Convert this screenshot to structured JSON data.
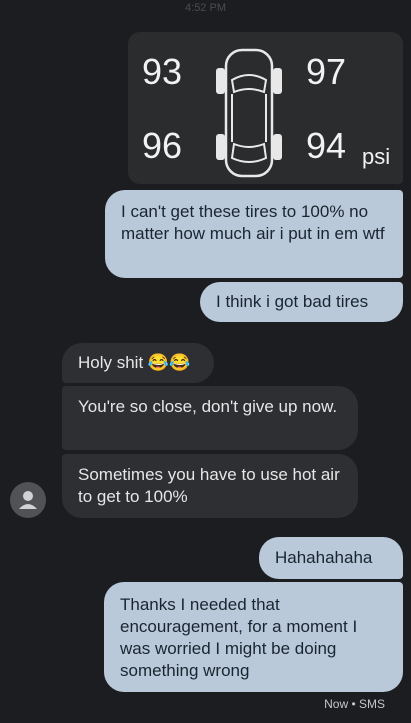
{
  "header": {
    "time": "4:52 PM"
  },
  "tire_image": {
    "front_left": "93",
    "front_right": "97",
    "rear_left": "96",
    "rear_right": "94",
    "unit": "psi"
  },
  "messages": [
    {
      "side": "out",
      "text": "I can't get these tires to 100% no matter how much air i put in em wtf"
    },
    {
      "side": "out",
      "text": "I think i got bad tires"
    },
    {
      "side": "in",
      "text": "Holy shit 😂😂"
    },
    {
      "side": "in",
      "text": "You're so close, don't give up now."
    },
    {
      "side": "in",
      "text": "Sometimes you have to use hot air to get to 100%"
    },
    {
      "side": "out",
      "text": "Hahahahaha"
    },
    {
      "side": "out",
      "text": "Thanks I needed that encouragement, for a moment I was worried I might be doing something wrong"
    }
  ],
  "footer": {
    "status": "Now • SMS"
  },
  "colors": {
    "outgoing": "#b9c9d9",
    "incoming": "#2e2f33",
    "background": "#1c1d20"
  },
  "icons": {
    "avatar": "person-icon"
  }
}
